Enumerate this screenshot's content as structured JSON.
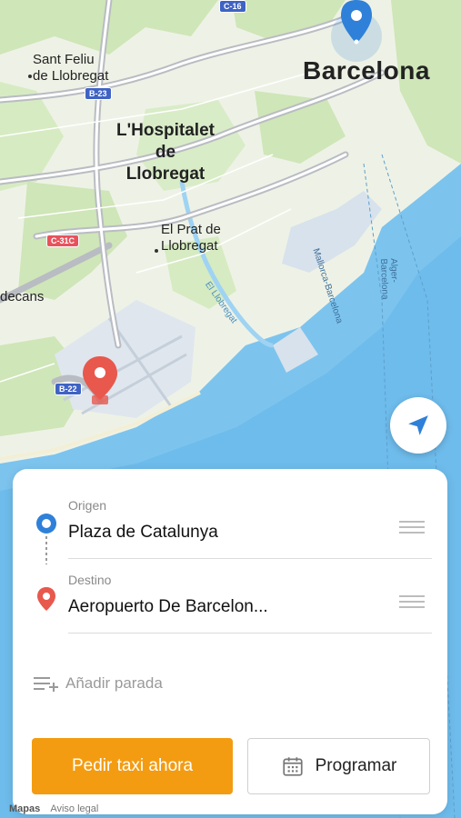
{
  "map": {
    "cities": {
      "barcelona": "Barcelona",
      "hospitalet": "L'Hospitalet\nde\nLlobregat",
      "sant_feliu": "Sant Feliu\nde Llobregat",
      "el_prat": "El Prat de\nLlobregat",
      "castelldefels_partial": "decans"
    },
    "roads": {
      "c16": "C-16",
      "b23": "B-23",
      "c31c": "C-31C",
      "b22": "B-22"
    },
    "water_labels": {
      "mallorca": "Mallorca-Barcelona",
      "alger": "Alger-Barcelona",
      "llobregat": "El Llobregat"
    },
    "attribution": "Mapas",
    "legal": "Aviso legal"
  },
  "colors": {
    "accent_orange": "#f39c12",
    "origin_blue": "#2f80d8",
    "destination_red": "#e8584d",
    "water": "#7cc4ee",
    "land": "#eef2e6",
    "park": "#cfe6b8"
  },
  "trip": {
    "origin_label": "Origen",
    "origin_value": "Plaza de Catalunya",
    "destination_label": "Destino",
    "destination_value": "Aeropuerto De Barcelon...",
    "add_stop": "Añadir parada"
  },
  "actions": {
    "request_now": "Pedir taxi ahora",
    "schedule": "Programar"
  },
  "icons": {
    "locate": "navigation-arrow-icon",
    "origin": "origin-pin-icon",
    "destination": "destination-pin-icon",
    "add_stop": "add-stop-icon",
    "calendar": "calendar-icon",
    "reorder": "drag-handle-icon"
  }
}
